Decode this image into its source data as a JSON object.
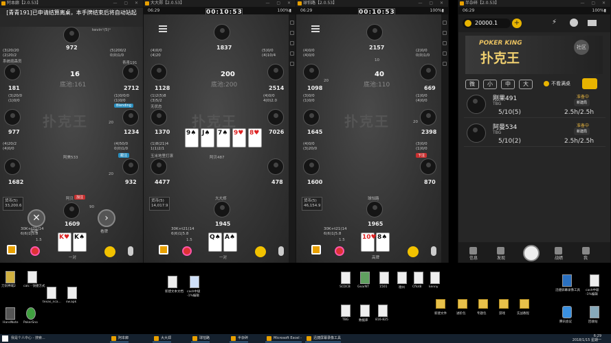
{
  "windows": [
    {
      "title": "阿本廊【2.0.53】",
      "status_time": "",
      "notice": "[青青191]已申请结算离桌，本手牌结束后将自动站起",
      "pot_label": "底池:161",
      "pot_value": "16",
      "seats": [
        {
          "name": "kevinᵒ(5)ᵃ",
          "chips": "972",
          "bet": "",
          "info": ""
        },
        {
          "name": "系统疏森员",
          "chips": "181",
          "bet": "",
          "info": "(3)20/20\n(2)20/2"
        },
        {
          "name": "青青191",
          "chips": "2712",
          "bet": "",
          "info": "(5)200/2\n0(0)1/0"
        },
        {
          "name": "Enagt",
          "chips": "977",
          "bet": "",
          "info": "(3)20/0\n(1)0/0"
        },
        {
          "name": "",
          "chips": "1234",
          "bet": "20",
          "info": "(1)0/0/0\n(1)0/0"
        },
        {
          "name": "阿美533",
          "chips": "1682",
          "bet": "",
          "info": "(4)20/2\n(4)0/0"
        },
        {
          "name": "",
          "chips": "932",
          "bet": "20",
          "info": "(4)50/0\n0(0)1/0"
        },
        {
          "name": "阿贝",
          "chips": "1609",
          "bet": "",
          "info": ""
        }
      ],
      "self_tag": "加注",
      "self_bet": "90",
      "hand_info": "30K+t21(14\n6(6)1|5.8",
      "hand_result": "一对",
      "hole_cards": [
        "K♥",
        "K♠"
      ],
      "fold_label": "弃牌",
      "call_label": "看牌",
      "lucky_label": "1.5",
      "side_box": "货币(5)\n33,200.6"
    },
    {
      "title": "大大郑【2.0.53】",
      "status_time": "06:29",
      "timer": "00:10:53",
      "pot_label": "底池:200",
      "pot_value": "200",
      "seats": [
        {
          "name": "",
          "chips": "1837",
          "bet": "",
          "info": ""
        },
        {
          "name": "",
          "chips": "1128",
          "bet": "",
          "info": "(4)0/0\n(4)20"
        },
        {
          "name": "",
          "chips": "2514",
          "bet": "",
          "info": "(5)0/0\n(4)10/4"
        },
        {
          "name": "无状态",
          "chips": "1370",
          "bet": "",
          "info": "(1)2(5)8\n(3)5/2"
        },
        {
          "name": "",
          "chips": "7026",
          "bet": "",
          "info": "(4)0/0\n4(0)2.0"
        },
        {
          "name": "玉米地里打滚",
          "chips": "4477",
          "bet": "",
          "info": "(1)8(21)4\n1(1)2/1"
        },
        {
          "name": "阿贝487",
          "chips": "478",
          "bet": "",
          "info": ""
        },
        {
          "name": "大大郑",
          "chips": "1945",
          "bet": "",
          "info": ""
        }
      ],
      "board": [
        "9♠",
        "J♠",
        "7♠",
        "9♥",
        "8♥"
      ],
      "hand_info": "30K+t21(14\n6(6)1|5.8",
      "hand_result": "一对",
      "hole_cards": [
        "Q♠",
        "A♠"
      ],
      "lucky_label": "1.5",
      "side_box": "货币(5)\n14,017.9"
    },
    {
      "title": "球怕路【2.0.53】",
      "status_time": "06:29",
      "timer": "00:10:53",
      "pot_label": "底池:110",
      "pot_value": "40",
      "seats": [
        {
          "name": "",
          "chips": "2157",
          "bet": "10",
          "info": ""
        },
        {
          "name": "",
          "chips": "1098",
          "bet": "20",
          "info": "(4)0/0\n(4)0/0"
        },
        {
          "name": "",
          "chips": "669",
          "bet": "",
          "info": "(2)0/0\n0(0)1/0"
        },
        {
          "name": "",
          "chips": "1645",
          "bet": "",
          "info": "(3)0/0\n(1)0/0"
        },
        {
          "name": "",
          "chips": "2398",
          "bet": "20",
          "info": "(1)0/0\n(4)0/0"
        },
        {
          "name": "",
          "chips": "1600",
          "bet": "",
          "info": "(4)0/0\n(3)20/0"
        },
        {
          "name": "",
          "chips": "870",
          "bet": "",
          "info": "(3)0/0\n(1)0/0"
        },
        {
          "name": "球怕路",
          "chips": "1965",
          "bet": "",
          "info": ""
        }
      ],
      "hand_info": "30K+t21(14\n6(6)1|5.8",
      "hand_result": "高牌",
      "hole_cards": [
        "10♥",
        "8♠"
      ],
      "lucky_label": "1.5",
      "side_box": "货币(5)\n46,154.9"
    }
  ],
  "lobby": {
    "title": "半杂碎【2.0.53】",
    "status_time": "06:29",
    "balance": "20000.1",
    "banner_en": "POKER KING",
    "banner_cn": "扑克王",
    "community_label": "社区",
    "filters": [
      "微",
      "小",
      "中",
      "大"
    ],
    "hide_full": "不看满桌",
    "tables": [
      {
        "name": "刚果491",
        "sub": "TBG",
        "status": "准备中",
        "tag": "新建局",
        "stakes": "5/10(5)",
        "blinds": "2.5h/2.5h"
      },
      {
        "name": "阿曼534",
        "sub": "TBG",
        "status": "准备中",
        "tag": "新建局",
        "stakes": "5/10(2)",
        "blinds": "2.5h/2.5h"
      }
    ],
    "nav": [
      "信息",
      "发现",
      "",
      "战绩",
      "我"
    ]
  },
  "desktop_icons": [
    {
      "label": "刀剑神域2"
    },
    {
      "label": "calc - 快捷方式"
    },
    {
      "label": "新建文本文档"
    },
    {
      "label": "cash中级\n-1%编辑"
    },
    {
      "label": "texas_nca..."
    },
    {
      "label": "sw.apk"
    },
    {
      "label": "HandNote"
    },
    {
      "label": "PokerSno"
    },
    {
      "label": "SCDCB"
    },
    {
      "label": "GearNT"
    },
    {
      "label": "1501"
    },
    {
      "label": "德州"
    },
    {
      "label": "Cflot8"
    },
    {
      "label": "kenny"
    },
    {
      "label": "TBG"
    },
    {
      "label": "数据库"
    },
    {
      "label": "816-825"
    },
    {
      "label": "新建文件"
    },
    {
      "label": "进阶包"
    },
    {
      "label": "专题包"
    },
    {
      "label": "游戏"
    },
    {
      "label": "实战教程"
    },
    {
      "label": "迅捷屏幕录像工具"
    },
    {
      "label": "cash中级\n-1%编辑"
    },
    {
      "label": "腾讯会议"
    },
    {
      "label": "回收站"
    }
  ],
  "taskbar": {
    "items": [
      "阿本廊",
      "大大郑",
      "球怕路",
      "半杂碎",
      "Microsoft Excel -",
      "迅捷屏幕录像工具"
    ],
    "search": "我是个人中心 - 搜索...",
    "time": "6:29",
    "date": "2018/1/15 星期一"
  }
}
